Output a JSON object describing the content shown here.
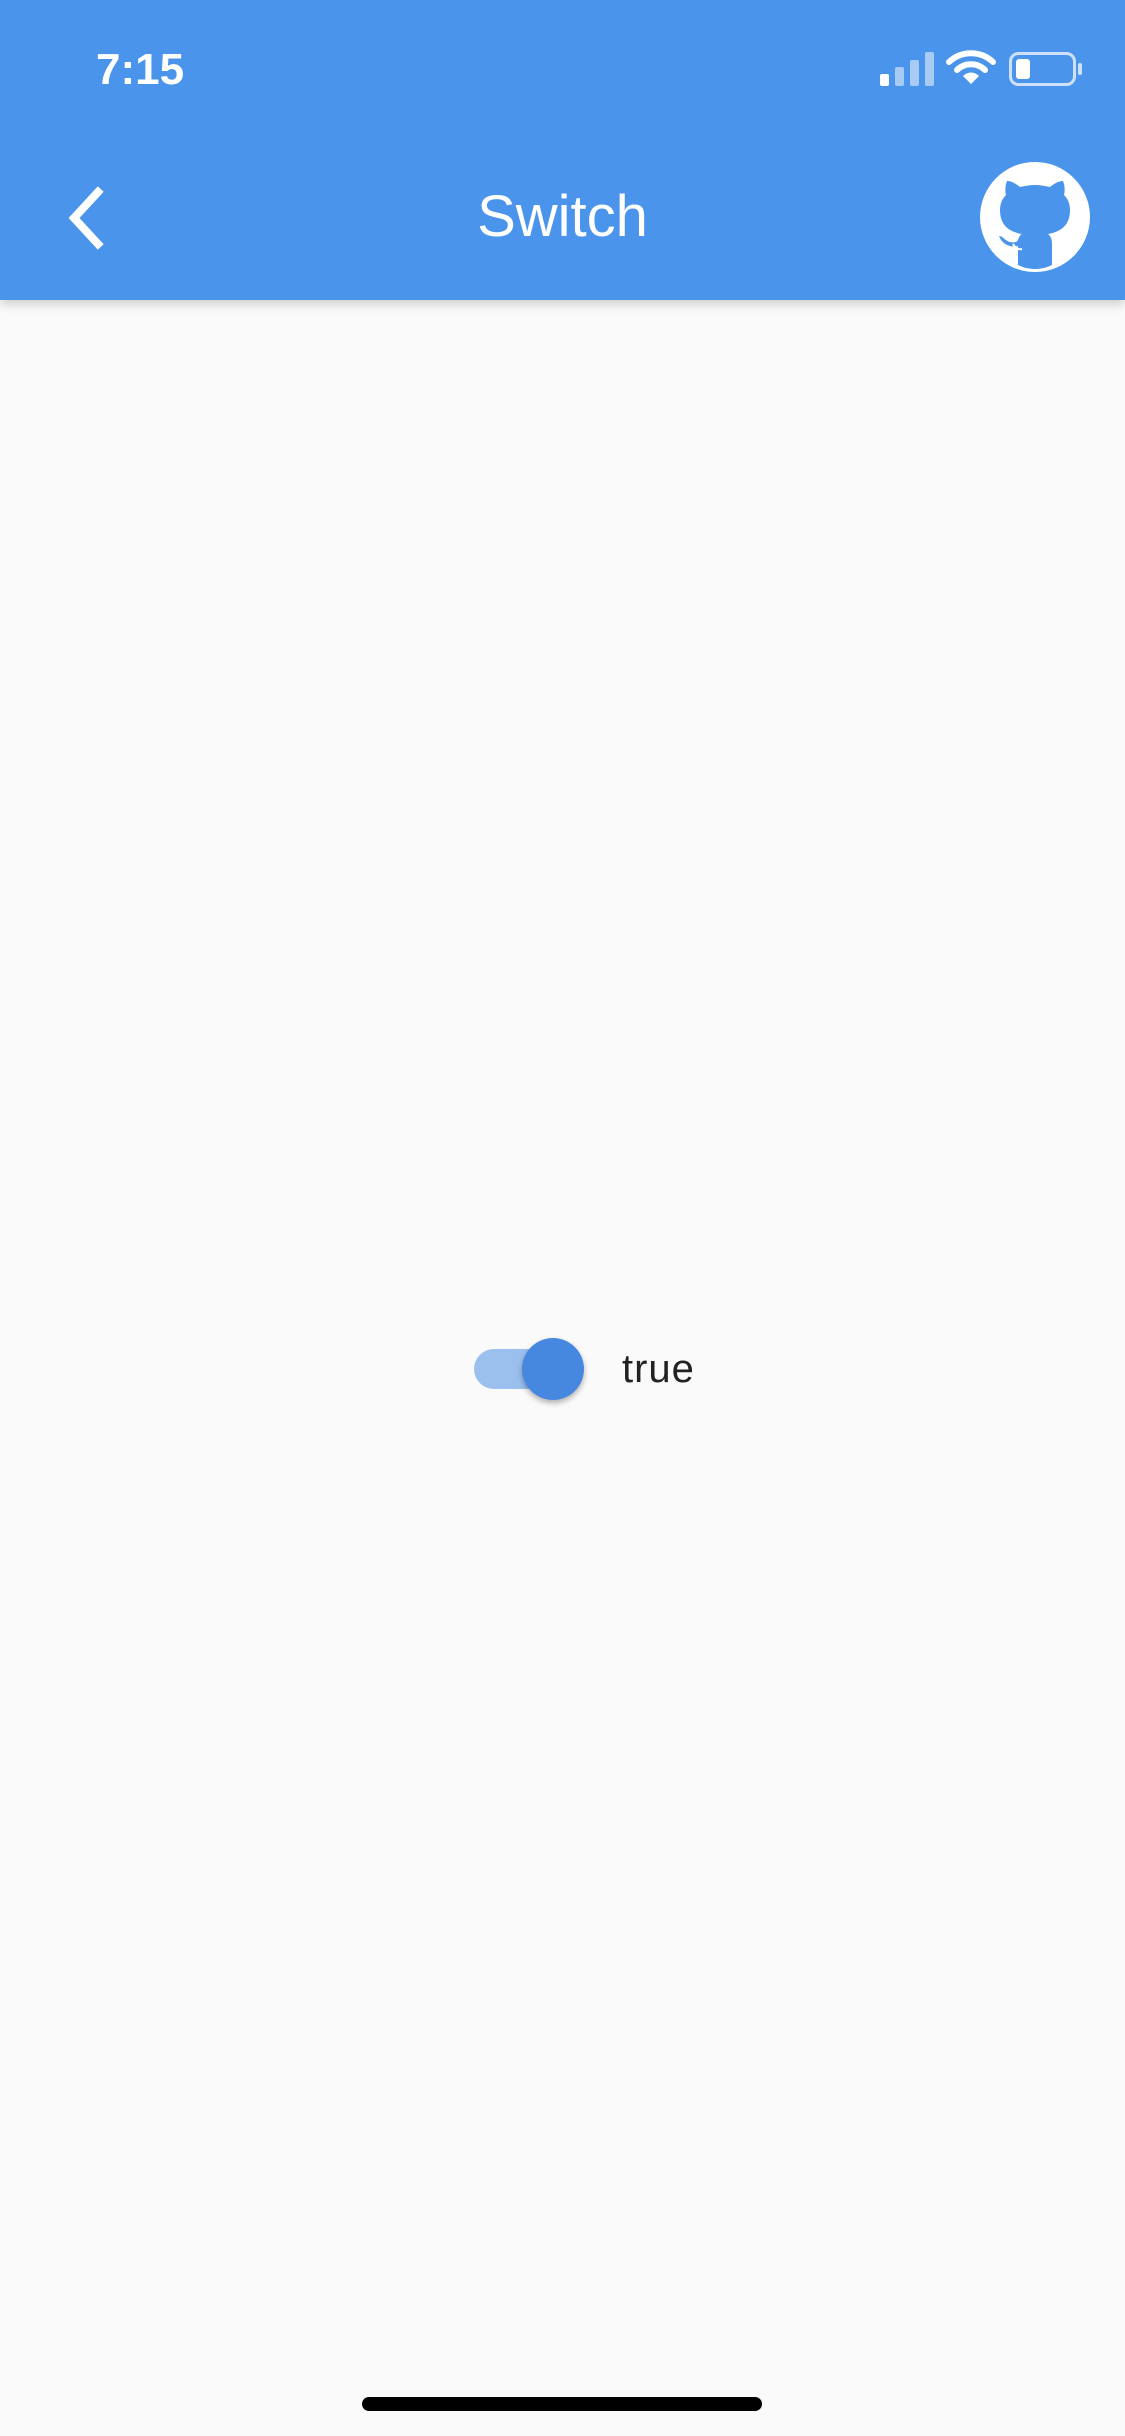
{
  "status_bar": {
    "time": "7:15"
  },
  "app_bar": {
    "title": "Switch",
    "back_icon": "chevron-left-icon",
    "github_icon": "github-icon",
    "background_color": "#4a94ec"
  },
  "switch": {
    "value": true,
    "label": "true",
    "active_color": "#4687df",
    "track_color": "#9bc0ee"
  }
}
